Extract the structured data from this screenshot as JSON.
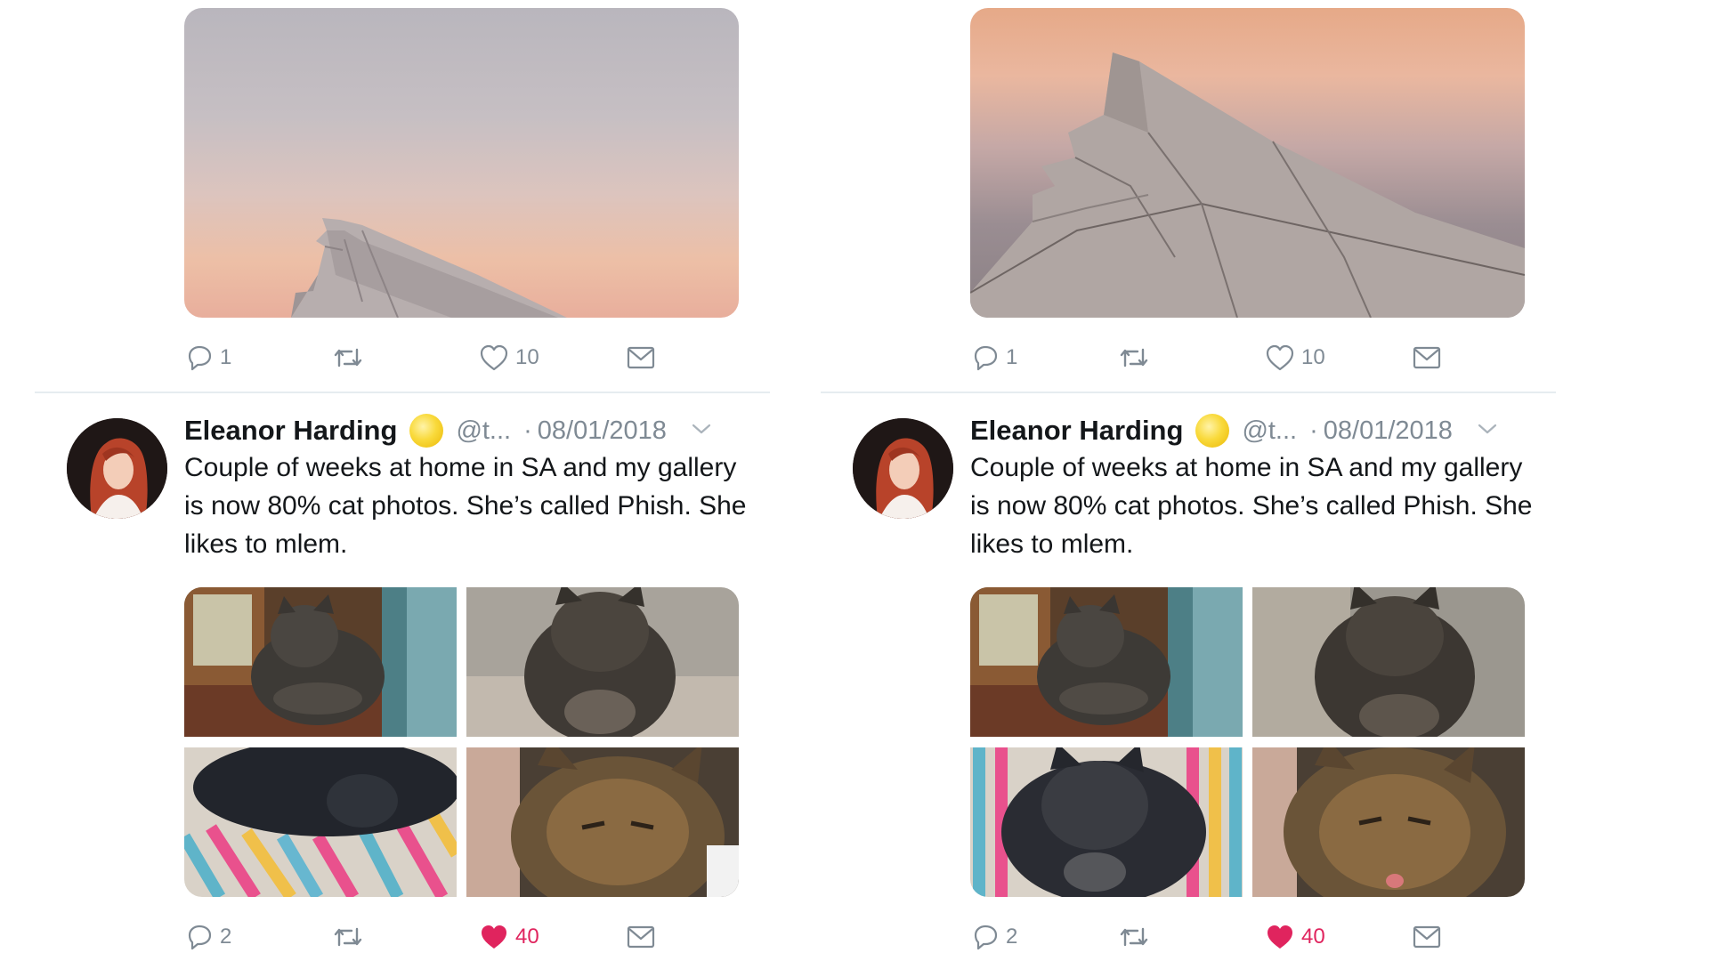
{
  "colors": {
    "icon_gray": "#7f8a94",
    "like_red": "#e0245e",
    "text": "#14171a",
    "divider": "#e6ecf0"
  },
  "panels": [
    {
      "id": "left",
      "top_tweet": {
        "photo_description_icon": "airplane-wing-photo",
        "actions": {
          "reply_count": "1",
          "retweet_count": "",
          "like_count": "10",
          "liked": false
        }
      },
      "tweet": {
        "author_name": "Eleanor Harding",
        "emoji": "yellow-circle-emoji",
        "handle": "@t...",
        "separator": "·",
        "date": "08/01/2018",
        "text": "Couple of weeks at home in SA and my gallery is now 80% cat photos. She’s called Phish. She likes to mlem.",
        "actions": {
          "reply_count": "2",
          "retweet_count": "",
          "like_count": "40",
          "liked": true
        }
      }
    },
    {
      "id": "right",
      "top_tweet": {
        "photo_description_icon": "airplane-wing-photo",
        "actions": {
          "reply_count": "1",
          "retweet_count": "",
          "like_count": "10",
          "liked": false
        }
      },
      "tweet": {
        "author_name": "Eleanor Harding",
        "emoji": "yellow-circle-emoji",
        "handle": "@t...",
        "separator": "·",
        "date": "08/01/2018",
        "text": "Couple of weeks at home in SA and my gallery is now 80% cat photos. She’s called Phish. She likes to mlem.",
        "actions": {
          "reply_count": "2",
          "retweet_count": "",
          "like_count": "40",
          "liked": true
        }
      }
    }
  ]
}
